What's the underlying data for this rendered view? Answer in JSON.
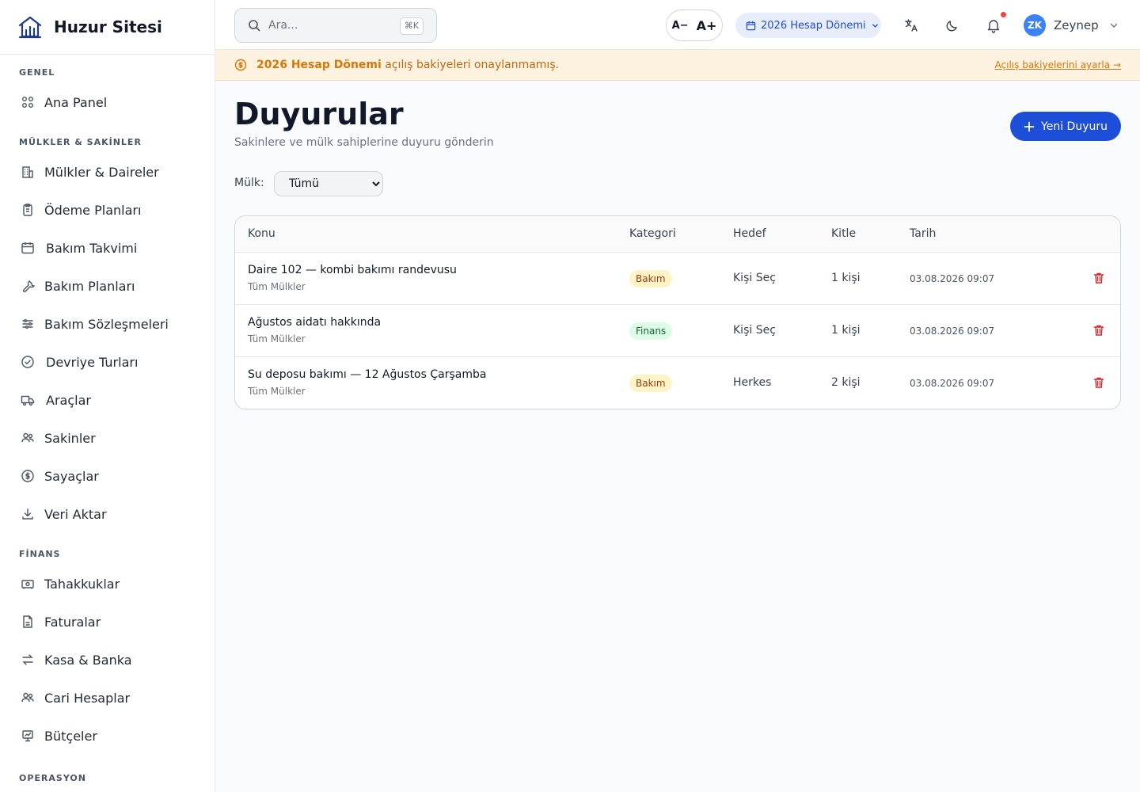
{
  "brand": {
    "name": "Huzur Sitesi",
    "logo_icon": "building-chart-icon"
  },
  "sidebar": {
    "sections": [
      {
        "title": "GENEL",
        "items": [
          {
            "label": "Ana Panel",
            "icon": "grid-icon"
          }
        ]
      },
      {
        "title": "MÜLKLER & SAKİNLER",
        "items": [
          {
            "label": "Mülkler & Daireler",
            "icon": "building-icon"
          },
          {
            "label": "Ödeme Planları",
            "icon": "clipboard-icon"
          },
          {
            "label": "Bakım Takvimi",
            "icon": "calendar-icon"
          },
          {
            "label": "Bakım Planları",
            "icon": "wrench-icon"
          },
          {
            "label": "Bakım Sözleşmeleri",
            "icon": "sliders-icon"
          },
          {
            "label": "Devriye Turları",
            "icon": "check-circle-icon"
          },
          {
            "label": "Araçlar",
            "icon": "truck-icon"
          },
          {
            "label": "Sakinler",
            "icon": "users-icon"
          },
          {
            "label": "Sayaçlar",
            "icon": "dollar-circle-icon"
          },
          {
            "label": "Veri Aktar",
            "icon": "download-icon"
          }
        ]
      },
      {
        "title": "FİNANS",
        "items": [
          {
            "label": "Tahakkuklar",
            "icon": "banknote-icon"
          },
          {
            "label": "Faturalar",
            "icon": "file-icon"
          },
          {
            "label": "Kasa & Banka",
            "icon": "transfer-icon"
          },
          {
            "label": "Cari Hesaplar",
            "icon": "users-icon"
          },
          {
            "label": "Bütçeler",
            "icon": "presentation-icon"
          }
        ]
      },
      {
        "title": "OPERASYON",
        "items": []
      }
    ]
  },
  "header": {
    "search_placeholder": "Ara...",
    "search_shortcut": "⌘K",
    "font_decrease": "A−",
    "font_increase": "A+",
    "period_label": "2026 Hesap Dönemi",
    "user_initials": "ZK",
    "user_name": "Zeynep"
  },
  "banner": {
    "bold_text": "2026 Hesap Dönemi",
    "text": " açılış bakiyeleri onaylanmamış.",
    "link": "Açılış bakiyelerini ayarla →"
  },
  "main": {
    "title": "Duyurular",
    "subtitle": "Sakinlere ve mülk sahiplerine duyuru gönderin",
    "new_button": "Yeni Duyuru",
    "filter_label": "Mülk:",
    "filter_value": "Tümü"
  },
  "table": {
    "headers": {
      "subject": "Konu",
      "category": "Kategori",
      "target": "Hedef",
      "audience": "Kitle",
      "date": "Tarih"
    },
    "rows": [
      {
        "subject": "Daire 102 — kombi bakımı randevusu",
        "meta": "Tüm Mülkler",
        "category": "Bakım",
        "target": "Kişi Seç",
        "audience": "1 kişi",
        "date": "03.08.2026 09:07"
      },
      {
        "subject": "Ağustos aidatı hakkında",
        "meta": "Tüm Mülkler",
        "category": "Finans",
        "target": "Kişi Seç",
        "audience": "1 kişi",
        "date": "03.08.2026 09:07"
      },
      {
        "subject": "Su deposu bakımı — 12 Ağustos Çarşamba",
        "meta": "Tüm Mülkler",
        "category": "Bakım",
        "target": "Herkes",
        "audience": "2 kişi",
        "date": "03.08.2026 09:07"
      }
    ]
  },
  "colors": {
    "primary": "#1d4ed8",
    "warning_bg": "#fdf1e0",
    "warning_text": "#d97706",
    "danger": "#dc2626",
    "bakim_badge": "#fef3c7",
    "finans_badge": "#dcfce7"
  }
}
